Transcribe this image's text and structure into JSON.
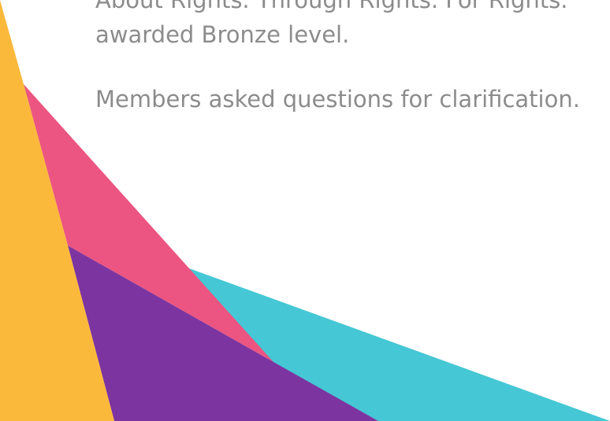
{
  "document": {
    "paragraphs": [
      {
        "lines": [
          "About Rights. Through Rights. For Rights.",
          "awarded Bronze level."
        ]
      },
      {
        "lines": [
          "Members asked questions for clarification."
        ]
      }
    ]
  },
  "decor": {
    "colors": {
      "yellow": "#FBB93C",
      "pink": "#EC5581",
      "purple": "#7C35A0",
      "teal": "#46C7D5"
    }
  }
}
